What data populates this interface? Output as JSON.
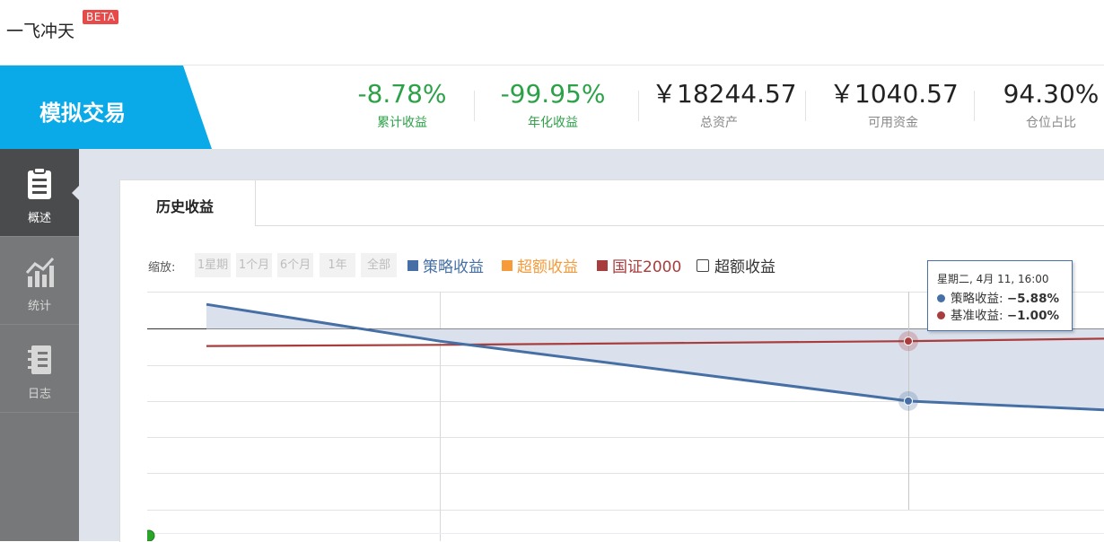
{
  "app": {
    "title": "一飞冲天",
    "badge": "BETA"
  },
  "header": {
    "mode": "模拟交易",
    "stats": [
      {
        "value": "-8.78%",
        "label": "累计收益"
      },
      {
        "value": "-99.95%",
        "label": "年化收益"
      },
      {
        "value": "￥18244.57",
        "label": "总资产"
      },
      {
        "value": "￥1040.57",
        "label": "可用资金"
      },
      {
        "value": "94.30%",
        "label": "仓位占比"
      }
    ]
  },
  "sidebar": {
    "items": [
      {
        "label": "概述",
        "icon": "clipboard-icon",
        "active": true
      },
      {
        "label": "统计",
        "icon": "bar-chart-icon",
        "active": false
      },
      {
        "label": "日志",
        "icon": "notebook-icon",
        "active": false
      }
    ]
  },
  "panel": {
    "tabs": [
      {
        "label": "历史收益"
      }
    ]
  },
  "chart_controls": {
    "zoom_label": "缩放:",
    "zoom_buttons": [
      "1星期",
      "1个月",
      "6个月",
      "1年",
      "全部"
    ]
  },
  "colors": {
    "strategy": "#4670a5",
    "excess": "#f79a3a",
    "benchmark": "#a83d3d",
    "accent": "#0aa9e8",
    "positive": "#2ca148"
  },
  "chart_data": {
    "type": "line",
    "legend": [
      {
        "name": "策略收益",
        "color": "#4670a5",
        "type": "square"
      },
      {
        "name": "超额收益",
        "color": "#f79a3a",
        "type": "square"
      },
      {
        "name": "国证2000",
        "color": "#a83d3d",
        "type": "square"
      },
      {
        "name": "超额收益",
        "color": "#444444",
        "type": "checkbox"
      }
    ],
    "series": [
      {
        "name": "策略收益",
        "values": [
          2.0,
          -1.0,
          -5.88,
          -6.6
        ]
      },
      {
        "name": "国证2000",
        "values": [
          -1.4,
          -1.3,
          -1.0,
          -0.8
        ]
      }
    ],
    "ylim": [
      -9,
      3
    ],
    "tooltip": {
      "header": "星期二, 4月 11, 16:00",
      "rows": [
        {
          "name": "策略收益",
          "value": "−5.88%",
          "color": "#4670a5"
        },
        {
          "name": "基准收益",
          "value": "−1.00%",
          "color": "#a83d3d"
        }
      ]
    }
  }
}
